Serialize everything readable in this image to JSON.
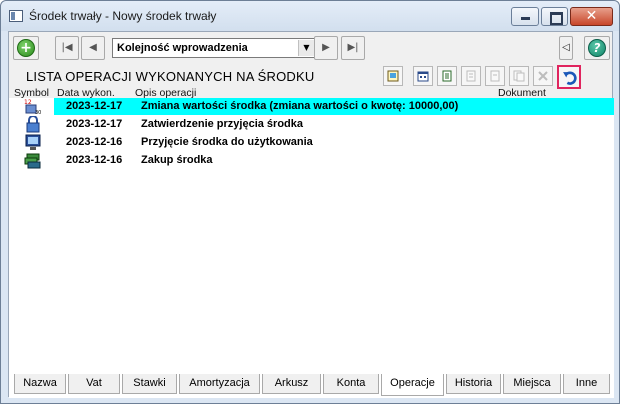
{
  "window": {
    "title": "Środek trwały - Nowy środek trwały",
    "close_glyph": "✕"
  },
  "toolbar": {
    "add_icon": "plus-icon",
    "first_glyph": "|◀",
    "prev_glyph": "◀",
    "next_glyph": "▶",
    "last_glyph": "▶|",
    "sort_value": "Kolejność wprowadzenia",
    "collapse_glyph": "◁",
    "help_glyph": "?"
  },
  "section": {
    "title": "LISTA OPERACJI WYKONANYCH NA ŚRODKU"
  },
  "columns": {
    "symbol": "Symbol",
    "date": "Data wykon.",
    "description": "Opis operacji",
    "document": "Dokument"
  },
  "operations": [
    {
      "date": "2023-12-17",
      "description": "Zmiana wartości środka (zmiana wartości o kwotę: 10000,00)",
      "symbol": "value-change-icon",
      "selected": true
    },
    {
      "date": "2023-12-17",
      "description": "Zatwierdzenie przyjęcia środka",
      "symbol": "lock-icon",
      "selected": false
    },
    {
      "date": "2023-12-16",
      "description": "Przyjęcie środka do użytkowania",
      "symbol": "monitor-icon",
      "selected": false
    },
    {
      "date": "2023-12-16",
      "description": "Zakup środka",
      "symbol": "money-icon",
      "selected": false
    }
  ],
  "tabs": [
    {
      "label": "Nazwa"
    },
    {
      "label": "Vat"
    },
    {
      "label": "Stawki"
    },
    {
      "label": "Amortyzacja"
    },
    {
      "label": "Arkusz"
    },
    {
      "label": "Konta"
    },
    {
      "label": "Operacje",
      "active": true
    },
    {
      "label": "Historia"
    },
    {
      "label": "Miejsca"
    },
    {
      "label": "Inne"
    }
  ],
  "colors": {
    "selection": "#00ffff",
    "highlight_border": "#e0245e"
  }
}
